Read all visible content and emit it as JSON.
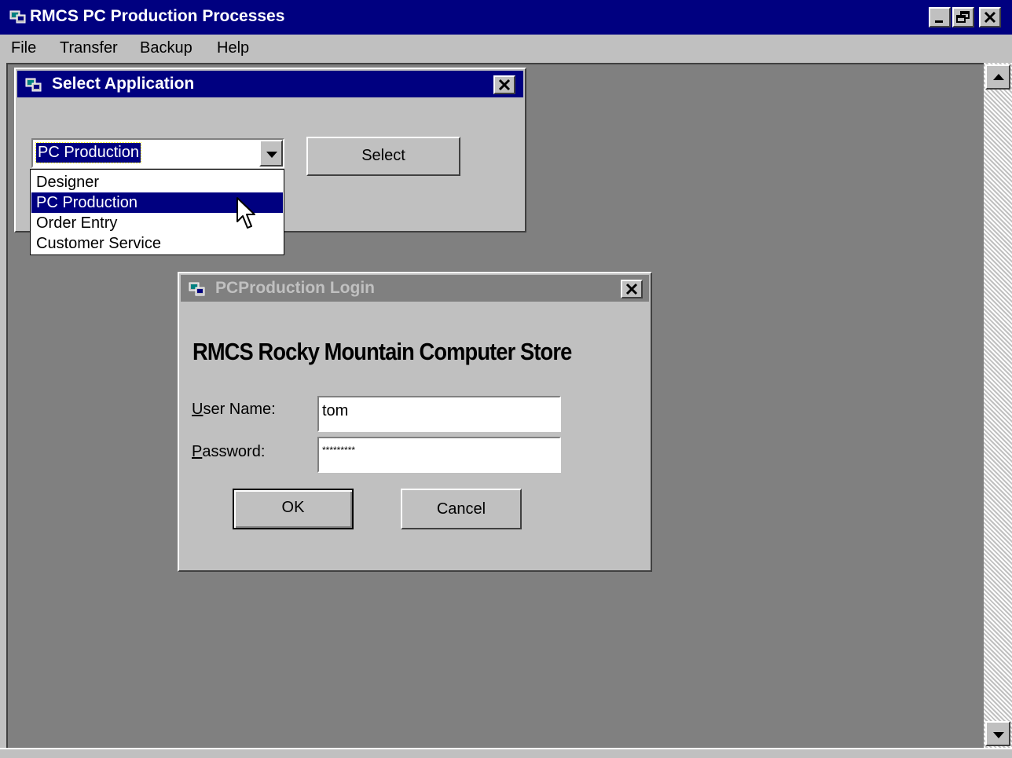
{
  "app": {
    "title": "RMCS PC Production Processes",
    "controls": [
      "minimize-icon",
      "restore-icon",
      "close-icon"
    ]
  },
  "menu": {
    "items": [
      {
        "label": "File"
      },
      {
        "label": "Transfer"
      },
      {
        "label": "Backup"
      },
      {
        "label": "Help"
      }
    ]
  },
  "select_app": {
    "title": "Select Application",
    "combo_value": "PC Production",
    "select_label": "Select",
    "options": [
      {
        "label": "Designer"
      },
      {
        "label": "PC Production"
      },
      {
        "label": "Order Entry"
      },
      {
        "label": "Customer Service"
      }
    ],
    "highlighted_option": "PC Production"
  },
  "login": {
    "title": "PCProduction Login",
    "heading": "RMCS Rocky Mountain Computer Store",
    "username_label_key": "U",
    "username_label_rest": "ser Name:",
    "username_value": "tom",
    "password_label_key": "P",
    "password_label_rest": "assword:",
    "password_value": "*********",
    "ok_label": "OK",
    "cancel_label": "Cancel"
  },
  "colors": {
    "active_title": "#000080",
    "inactive_title": "#808080",
    "face": "#c0c0c0",
    "workspace": "#808080"
  }
}
